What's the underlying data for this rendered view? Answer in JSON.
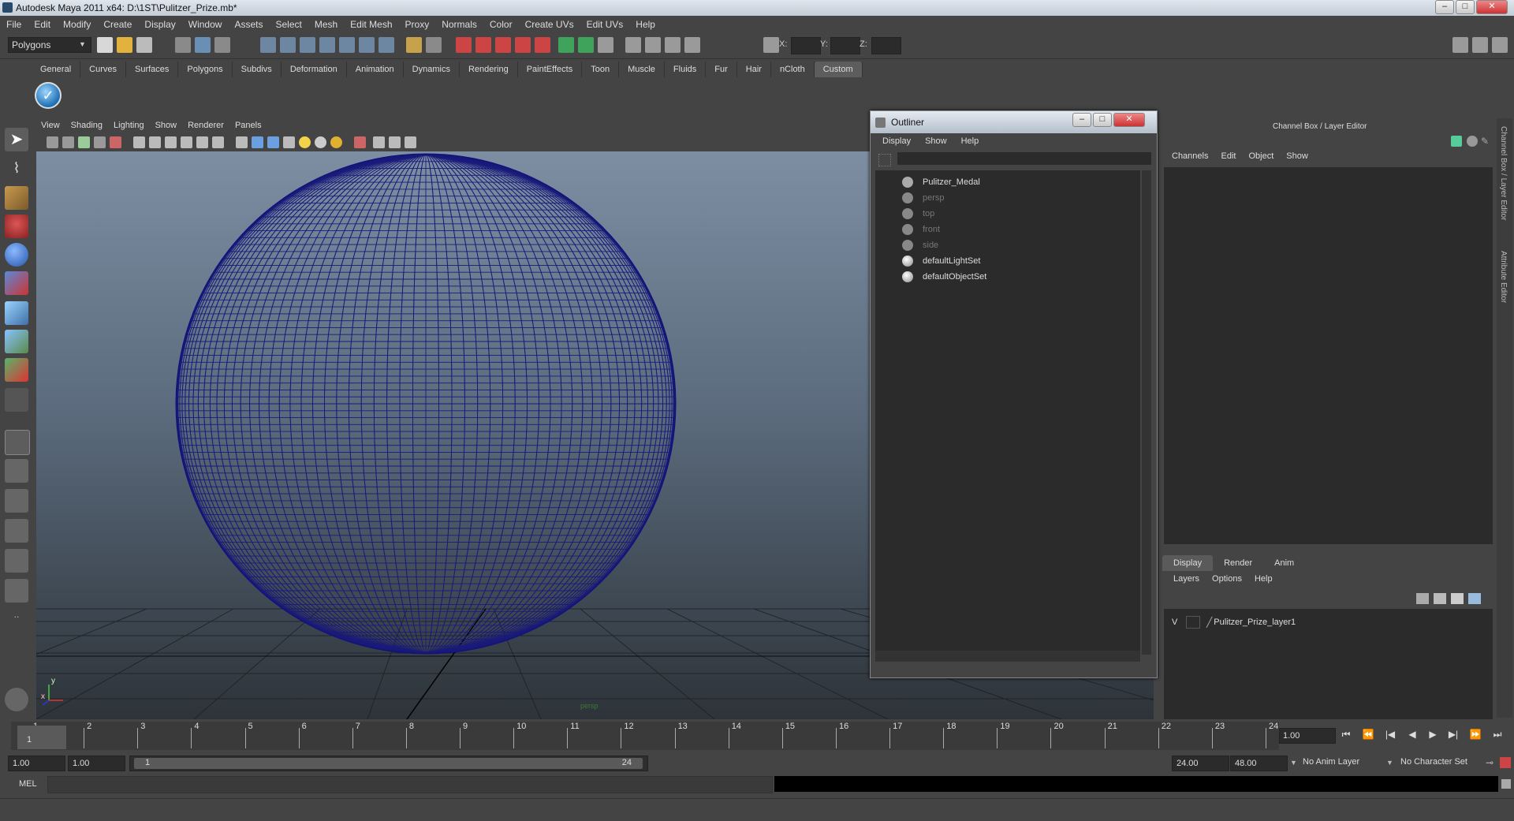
{
  "window": {
    "title": "Autodesk Maya 2011 x64: D:\\1ST\\Pulitzer_Prize.mb*"
  },
  "menubar": [
    "File",
    "Edit",
    "Modify",
    "Create",
    "Display",
    "Window",
    "Assets",
    "Select",
    "Mesh",
    "Edit Mesh",
    "Proxy",
    "Normals",
    "Color",
    "Create UVs",
    "Edit UVs",
    "Help"
  ],
  "statusline": {
    "mode": "Polygons",
    "x_label": "X:",
    "y_label": "Y:",
    "z_label": "Z:"
  },
  "shelf_tabs": [
    "General",
    "Curves",
    "Surfaces",
    "Polygons",
    "Subdivs",
    "Deformation",
    "Animation",
    "Dynamics",
    "Rendering",
    "PaintEffects",
    "Toon",
    "Muscle",
    "Fluids",
    "Fur",
    "Hair",
    "nCloth",
    "Custom"
  ],
  "shelf_tab_active": "Custom",
  "viewport_menu": [
    "View",
    "Shading",
    "Lighting",
    "Show",
    "Renderer",
    "Panels"
  ],
  "viewport": {
    "camera_label": "persp",
    "axis_y": "y",
    "axis_x": "x"
  },
  "outliner": {
    "title": "Outliner",
    "menu": [
      "Display",
      "Show",
      "Help"
    ],
    "items": [
      {
        "label": "Pulitzer_Medal",
        "dim": false,
        "icon": "mesh-icon"
      },
      {
        "label": "persp",
        "dim": true,
        "icon": "camera-icon"
      },
      {
        "label": "top",
        "dim": true,
        "icon": "camera-icon"
      },
      {
        "label": "front",
        "dim": true,
        "icon": "camera-icon"
      },
      {
        "label": "side",
        "dim": true,
        "icon": "camera-icon"
      },
      {
        "label": "defaultLightSet",
        "dim": false,
        "icon": "set-icon"
      },
      {
        "label": "defaultObjectSet",
        "dim": false,
        "icon": "set-icon"
      }
    ]
  },
  "channelbox": {
    "title": "Channel Box / Layer Editor",
    "menu": [
      "Channels",
      "Edit",
      "Object",
      "Show"
    ],
    "layer_tabs": [
      "Display",
      "Render",
      "Anim"
    ],
    "layer_menu": [
      "Layers",
      "Options",
      "Help"
    ],
    "layer": {
      "visible": "V",
      "name": "Pulitzer_Prize_layer1"
    },
    "side_label_1": "Channel Box / Layer Editor",
    "side_label_2": "Attribute Editor"
  },
  "timeslider": {
    "ticks": [
      "1",
      "2",
      "3",
      "4",
      "5",
      "6",
      "7",
      "8",
      "9",
      "10",
      "11",
      "12",
      "13",
      "14",
      "15",
      "16",
      "17",
      "18",
      "19",
      "20",
      "21",
      "22",
      "23",
      "24"
    ],
    "current_frame": "1",
    "current_time": "1.00"
  },
  "rangebar": {
    "start": "1.00",
    "start2": "1.00",
    "range_start": "1",
    "range_end": "24",
    "end": "24.00",
    "end2": "48.00",
    "anim_layer": "No Anim Layer",
    "character_set": "No Character Set"
  },
  "cmdline": {
    "label": "MEL"
  },
  "colors": {
    "accent_blue": "#1a1a7a",
    "ui_bg": "#444444",
    "field_bg": "#2b2b2b"
  }
}
